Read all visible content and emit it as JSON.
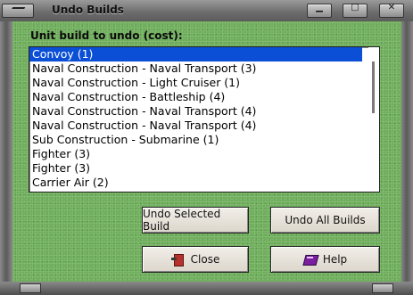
{
  "window": {
    "title": "Undo Builds",
    "controls": [
      "minimize",
      "maximize",
      "close"
    ]
  },
  "prompt": "Unit build to undo (cost):",
  "list": {
    "selected_index": 0,
    "items": [
      "Convoy (1)",
      "Naval Construction - Naval Transport (3)",
      "Naval Construction - Light Cruiser (1)",
      "Naval Construction - Battleship (4)",
      "Naval Construction - Naval Transport (4)",
      "Naval Construction - Naval Transport (4)",
      "Sub Construction - Submarine (1)",
      "Fighter (3)",
      "Fighter (3)",
      "Carrier Air (2)"
    ]
  },
  "buttons": {
    "undo_selected": "Undo Selected Build",
    "undo_all": "Undo All Builds",
    "close": "Close",
    "help": "Help"
  },
  "colors": {
    "background_felt": "#6fae5c",
    "selection": "#0a4fd6",
    "button_face": "#e6e1d8"
  }
}
